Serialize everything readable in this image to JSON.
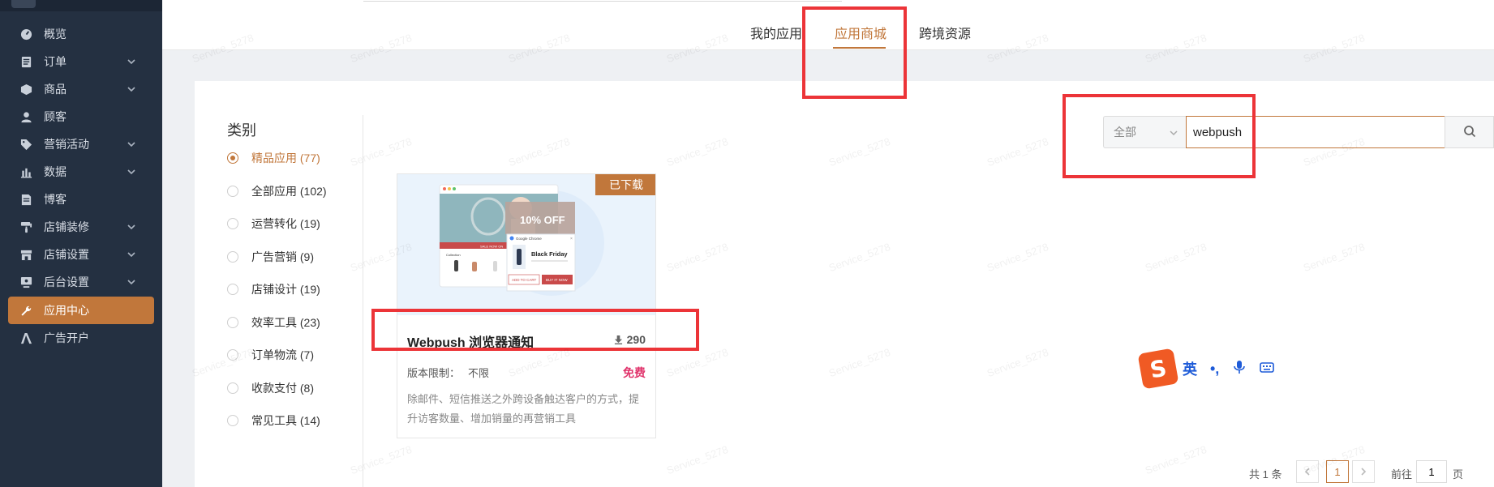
{
  "sidebar": {
    "items": [
      {
        "label": "概览",
        "icon": "dashboard-icon",
        "expandable": false,
        "active": false
      },
      {
        "label": "订单",
        "icon": "order-icon",
        "expandable": true,
        "active": false
      },
      {
        "label": "商品",
        "icon": "box-icon",
        "expandable": true,
        "active": false
      },
      {
        "label": "顾客",
        "icon": "user-icon",
        "expandable": false,
        "active": false
      },
      {
        "label": "营销活动",
        "icon": "tag-icon",
        "expandable": true,
        "active": false
      },
      {
        "label": "数据",
        "icon": "bar-chart-icon",
        "expandable": true,
        "active": false
      },
      {
        "label": "博客",
        "icon": "document-icon",
        "expandable": false,
        "active": false
      },
      {
        "label": "店铺装修",
        "icon": "paint-roller-icon",
        "expandable": true,
        "active": false
      },
      {
        "label": "店铺设置",
        "icon": "store-icon",
        "expandable": true,
        "active": false
      },
      {
        "label": "后台设置",
        "icon": "monitor-gear-icon",
        "expandable": true,
        "active": false
      },
      {
        "label": "应用中心",
        "icon": "wrench-icon",
        "expandable": false,
        "active": true
      },
      {
        "label": "广告开户",
        "icon": "ad-icon",
        "expandable": false,
        "active": false
      }
    ]
  },
  "tabs": {
    "my_apps": "我的应用",
    "app_store": "应用商城",
    "cross_border": "跨境资源"
  },
  "categories": {
    "title": "类别",
    "items": [
      {
        "label": "精品应用 (77)",
        "selected": true
      },
      {
        "label": "全部应用 (102)",
        "selected": false
      },
      {
        "label": "运营转化 (19)",
        "selected": false
      },
      {
        "label": "广告营销 (9)",
        "selected": false
      },
      {
        "label": "店铺设计 (19)",
        "selected": false
      },
      {
        "label": "效率工具 (23)",
        "selected": false
      },
      {
        "label": "订单物流 (7)",
        "selected": false
      },
      {
        "label": "收款支付 (8)",
        "selected": false
      },
      {
        "label": "常见工具 (14)",
        "selected": false
      }
    ]
  },
  "search": {
    "scope": "全部",
    "value": "webpush"
  },
  "app_card": {
    "badge": "已下载",
    "title": "Webpush 浏览器通知",
    "downloads": "290",
    "version_label": "版本限制：",
    "version_value": "不限",
    "price": "免费",
    "description": "除邮件、短信推送之外跨设备触达客户的方式，提升访客数量、增加销量的再营销工具",
    "thumb": {
      "discount": "10% OFF",
      "popup_browser": "Google Chrome",
      "popup_title": "Black Friday",
      "add_to_cart": "ADD TO CART",
      "buy_it_now": "BUY IT NOW",
      "collection": "Collection",
      "sale_text": "SALE NOW ON"
    }
  },
  "pagination": {
    "total": "共 1 条",
    "current": "1",
    "goto_label": "前往",
    "goto_value": "1",
    "page_label": "页"
  },
  "ime": {
    "logo": "S",
    "lang": "英",
    "punct": "•,"
  },
  "watermark": "Service_5278",
  "colors": {
    "accent": "#c1773b",
    "sidebar_bg": "#243041",
    "highlight_red": "#ec3438",
    "price": "#e0336b"
  }
}
